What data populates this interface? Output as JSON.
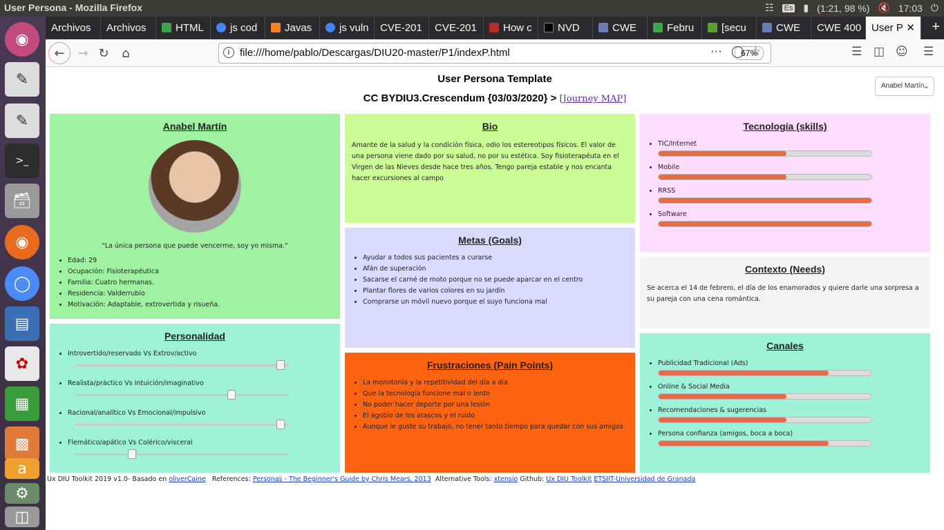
{
  "os": {
    "window_title": "User Persona - Mozilla Firefox",
    "keyboard": "Es",
    "battery": "(1:21, 98 %)",
    "clock": "17:03"
  },
  "tabs": [
    {
      "label": "Archivos",
      "color": ""
    },
    {
      "label": "Archivos",
      "color": ""
    },
    {
      "label": "HTML",
      "color": "#3fa34d"
    },
    {
      "label": "js cod",
      "color": "#4285f4"
    },
    {
      "label": "Javas",
      "color": "#f48024"
    },
    {
      "label": "js vuln",
      "color": "#4285f4"
    },
    {
      "label": "CVE-201",
      "color": ""
    },
    {
      "label": "CVE-201",
      "color": ""
    },
    {
      "label": "How c",
      "color": "#b92b27"
    },
    {
      "label": "NVD",
      "color": "#000000"
    },
    {
      "label": "CWE",
      "color": "#6a7bb8"
    },
    {
      "label": "Febru",
      "color": "#3fa34d"
    },
    {
      "label": "[secu",
      "color": "#5aa02c"
    },
    {
      "label": "CWE",
      "color": "#6a7bb8"
    },
    {
      "label": "CWE 400",
      "color": ""
    },
    {
      "label": "User P",
      "color": ""
    }
  ],
  "navbar": {
    "url": "file:///home/pablo/Descargas/DIU20-master/P1/indexP.html",
    "zoom": "67%"
  },
  "page": {
    "title": "User Persona Template",
    "subtitle": "CC BYDIU3.Crescendum {03/03/2020} >",
    "journey_link": "[Journey MAP]",
    "persona_select": "Anabel Martín"
  },
  "persona": {
    "name": "Anabel Martín",
    "quote": "\"La única persona que puede vencerme, soy yo misma.\"",
    "facts": [
      "Edad: 29",
      "Ocupación: Fisioterapéutica",
      "Familia: Cuatro hermanas.",
      "Residencia: Valderrubio",
      "Motivación: Adaptable, extrovertida y risueña."
    ]
  },
  "bio": {
    "title": "Bio",
    "text": "Amante de la salud y la condición física, odio los estereotipos físicos. El valor de una persona viene dado por su salud, no por su estética. Soy fisioterapéuta en el Virgen de las Nieves desde hace tres años. Tengo pareja estable y nos encanta hacer excursiones al campo"
  },
  "goals": {
    "title": "Metas (Goals)",
    "items": [
      "Ayudar a todos sus pacientes a curarse",
      "Afán de superación",
      "Sacarse el carné de moto porque no se puede aparcar en el centro",
      "Plantar flores de varios colores en su jardín",
      "Comprarse un móvil nuevo porque el suyo funciona mal"
    ]
  },
  "frustrations": {
    "title": "Frustraciones (Pain Points)",
    "items": [
      "La monotonía y la repetitividad del día a día",
      "Que la tecnología funcione mal o lento",
      "No poder hacer deporte por una lesión",
      "El agobio de los atascos y el ruido",
      "Aunque le guste su trabajo, no tener tanto tiempo para quedar con sus amigos"
    ]
  },
  "personality": {
    "title": "Personalidad",
    "items": [
      {
        "label": "Introvertido/reservado Vs Extrov/activo",
        "value": 0.98
      },
      {
        "label": "Realista/práctico Vs Intuición/imaginativo",
        "value": 0.74
      },
      {
        "label": "Racional/analítico Vs Emocional/impulsivo",
        "value": 0.98
      },
      {
        "label": "Flemático/apático Vs Colérico/visceral",
        "value": 0.26
      }
    ]
  },
  "tech": {
    "title": "Tecnología (skills)",
    "items": [
      {
        "label": "TIC/Internet",
        "value": 0.6
      },
      {
        "label": "Mobile",
        "value": 0.6
      },
      {
        "label": "RRSS",
        "value": 1.0
      },
      {
        "label": "Software",
        "value": 1.0
      }
    ]
  },
  "context": {
    "title": "Contexto (Needs)",
    "text": "Se acerca el 14 de febrero, el día de los enamorados y quiere darle una sorpresa a su pareja con una cena romántica."
  },
  "channels": {
    "title": "Canales",
    "items": [
      {
        "label": "Publicidad Tradicional (Ads)",
        "value": 0.8
      },
      {
        "label": "Online & Social Media",
        "value": 0.6
      },
      {
        "label": "Recomendaciones & sugerencias",
        "value": 0.6
      },
      {
        "label": "Persona confianza (amigos, boca a boca)",
        "value": 0.8
      }
    ]
  },
  "footer": {
    "prefix": "Ux DIU Toolkit 2019 v1.0- Basado en",
    "link1": "oliverCaine",
    "refs": "References:",
    "link2": "Personas - The Beginner's Guide by Chris Mears, 2013",
    "alt": "Alternative Tools:",
    "link3": "xtensio",
    "github": "Github:",
    "link4": "Ux DIU Toolkit",
    "link5": "ETSIIT-Universidad de Granada"
  },
  "colors": {
    "bar_fill": "#e96a43",
    "persona_bg": "#9ef2a2",
    "bio_bg": "#ccfc96",
    "tech_bg": "#fedcfe",
    "goals_bg": "#dadafc",
    "frustrations_bg": "#fe6312",
    "channels_bg": "#9ef2d8"
  }
}
